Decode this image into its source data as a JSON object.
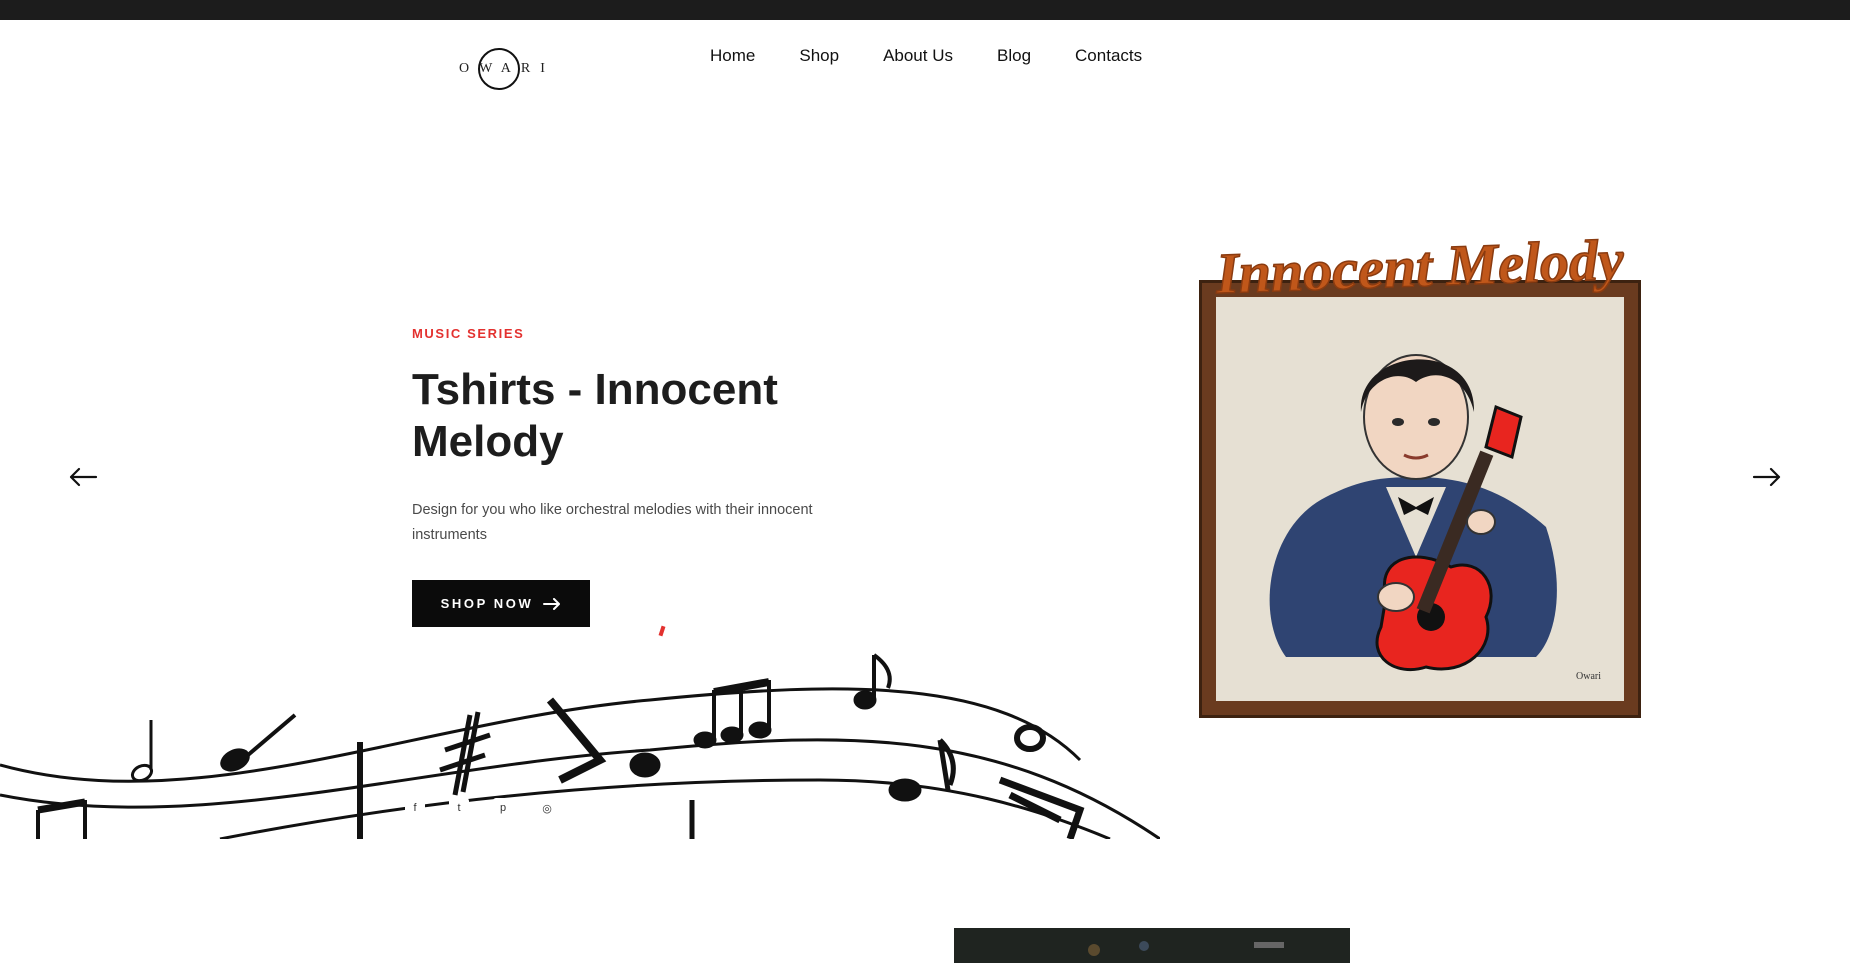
{
  "brand": {
    "logo_text": "OWARI"
  },
  "nav": {
    "items": [
      "Home",
      "Shop",
      "About Us",
      "Blog",
      "Contacts"
    ]
  },
  "hero": {
    "eyebrow": "MUSIC SERIES",
    "title": "Tshirts - Innocent Melody",
    "description": "Design for you who like orchestral melodies with their innocent instruments",
    "cta_label": "SHOP NOW",
    "art_title": "Innocent Melody",
    "art_signature": "Owari"
  },
  "social": {
    "icons": [
      "facebook-icon",
      "twitter-icon",
      "pinterest-icon",
      "instagram-icon"
    ]
  },
  "colors": {
    "accent": "#e3312f",
    "art_title": "#c0571a",
    "button_bg": "#0b0b0b",
    "guitar": "#e8251f"
  }
}
